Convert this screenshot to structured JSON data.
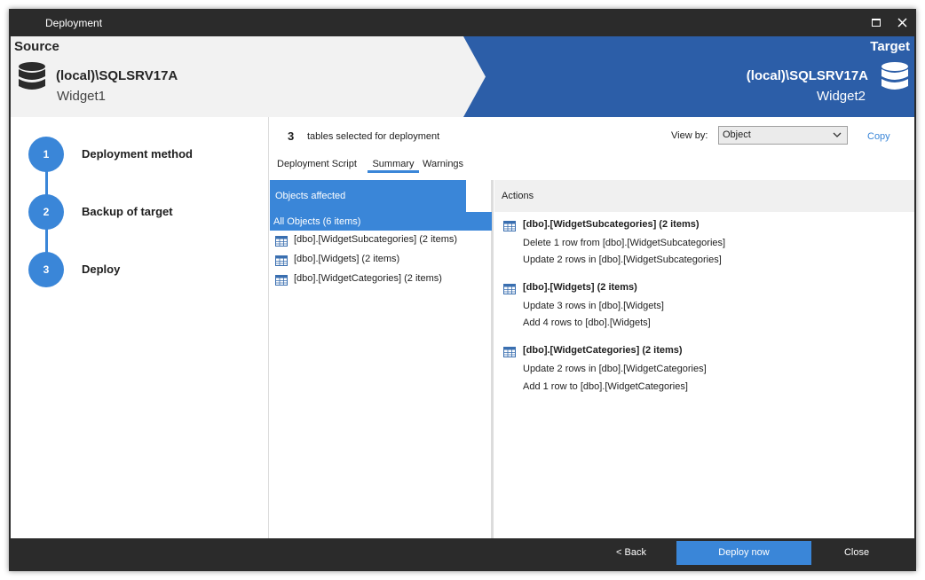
{
  "window": {
    "title": "Deployment"
  },
  "header": {
    "source": {
      "label": "Source",
      "server": "(local)\\SQLSRV17A",
      "database": "Widget1"
    },
    "target": {
      "label": "Target",
      "server": "(local)\\SQLSRV17A",
      "database": "Widget2"
    }
  },
  "steps": [
    {
      "number": "1",
      "label": "Deployment method"
    },
    {
      "number": "2",
      "label": "Backup of target"
    },
    {
      "number": "3",
      "label": "Deploy"
    }
  ],
  "summary": {
    "count": "3",
    "count_text": "tables selected for deployment",
    "view_by_label": "View by:",
    "view_by_value": "Object",
    "copy_label": "Copy"
  },
  "tabs": [
    "Deployment Script",
    "Summary",
    "Warnings"
  ],
  "objects": {
    "header": "Objects affected",
    "all": "All Objects (6 items)",
    "items": [
      "[dbo].[WidgetSubcategories] (2 items)",
      "[dbo].[Widgets] (2 items)",
      "[dbo].[WidgetCategories] (2 items)"
    ]
  },
  "actions": {
    "header": "Actions",
    "groups": [
      {
        "title": "[dbo].[WidgetSubcategories] (2 items)",
        "lines": [
          "Delete 1 row from [dbo].[WidgetSubcategories]",
          "Update 2 rows in [dbo].[WidgetSubcategories]"
        ]
      },
      {
        "title": "[dbo].[Widgets] (2 items)",
        "lines": [
          "Update 3 rows in [dbo].[Widgets]",
          "Add 4 rows to [dbo].[Widgets]"
        ]
      },
      {
        "title": "[dbo].[WidgetCategories] (2 items)",
        "lines": [
          "Update 2 rows in [dbo].[WidgetCategories]",
          "Add 1 row to [dbo].[WidgetCategories]"
        ]
      }
    ]
  },
  "footer": {
    "back": "< Back",
    "deploy": "Deploy now",
    "close": "Close"
  },
  "colors": {
    "accent": "#3a86d8",
    "chrome": "#2b2b2b"
  }
}
